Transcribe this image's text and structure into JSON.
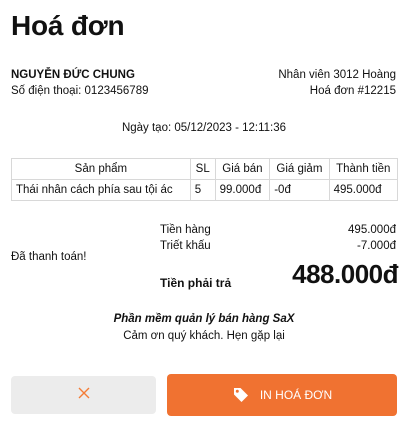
{
  "header": {
    "title": "Hoá đơn"
  },
  "customer": {
    "name": "NGUYỄN ĐỨC CHUNG",
    "phone": "Số điện thoại: 0123456789"
  },
  "staff": {
    "name": "Nhân viên 3012 Hoàng",
    "invoice_no": "Hoá đơn #12215"
  },
  "created": "Ngày tạo: 05/12/2023 - 12:11:36",
  "table": {
    "headers": [
      "Sản phẩm",
      "SL",
      "Giá bán",
      "Giá giảm",
      "Thành tiền"
    ],
    "rows": [
      [
        "Thái nhân cách phía sau tội ác",
        "5",
        "99.000đ",
        "-0đ",
        "495.000đ"
      ]
    ]
  },
  "summary": {
    "subtotal_label": "Tiền hàng",
    "subtotal_value": "495.000đ",
    "discount_label": "Triết khấu",
    "discount_value": "-7.000đ",
    "paid_label": "Đã thanh toán!",
    "total_label": "Tiền phải trả",
    "total_value": "488.000đ"
  },
  "footer": {
    "line1": "Phần mềm quản lý bán hàng SaX",
    "line2": "Cảm ơn quý khách. Hẹn gặp lại"
  },
  "actions": {
    "cancel_icon": "close-icon",
    "print_label": "IN HOÁ ĐƠN",
    "print_icon": "tag-icon"
  },
  "colors": {
    "accent": "#f07231",
    "cancel_bg": "#ececec"
  }
}
